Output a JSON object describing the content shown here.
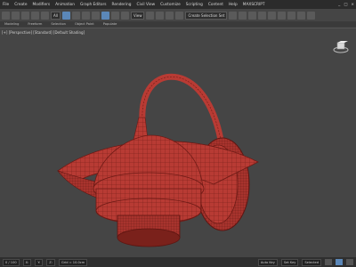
{
  "menubar": {
    "items": [
      "File",
      "Create",
      "Modifiers",
      "Animation",
      "Graph Editors",
      "Rendering",
      "Civil View",
      "Customize",
      "Scripting",
      "Content",
      "Help",
      "MAXSCRIPT"
    ],
    "right_items": [
      "_",
      "□",
      "×"
    ]
  },
  "toolbar": {
    "filter_value": "All",
    "view_value": "View",
    "selection_set": "Create Selection Set"
  },
  "ribbon": {
    "tabs": [
      "Modeling",
      "Freeform",
      "Selection",
      "Object Paint",
      "Populate"
    ]
  },
  "viewport": {
    "label": "[+] [Perspective] [Standard] [Default Shading]",
    "model_color": "#b83b34",
    "wire_color": "#6e1a15",
    "background": "#454545"
  },
  "status": {
    "frame": "0 / 100",
    "coords": {
      "x": "X:",
      "y": "Y:",
      "z": "Z:"
    },
    "grid": "Grid = 10.0cm",
    "auto_key": "Auto Key",
    "set_key": "Set Key",
    "selected": "Selected"
  },
  "colors": {
    "accent": "#5b87b8",
    "menubar": "#2b2b2b",
    "toolbar": "#454545"
  }
}
